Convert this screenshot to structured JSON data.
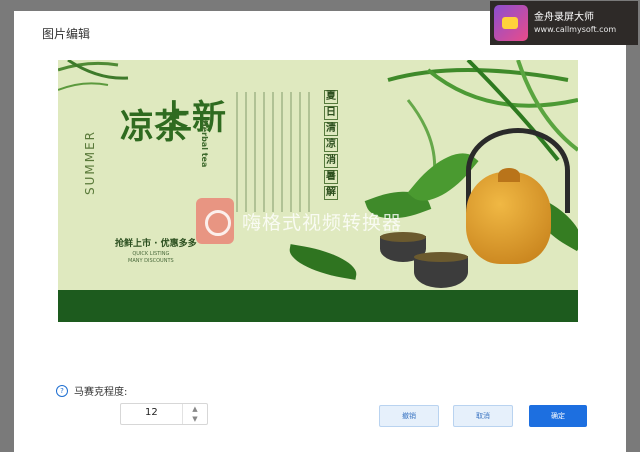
{
  "dialog": {
    "title": "图片编辑"
  },
  "banner": {
    "title_part1": "凉茶",
    "title_part2": "上新",
    "summer": "SUMMER",
    "herbal": "Herbal tea",
    "tagline": "抢鲜上市 · 优惠多多",
    "tagline_sub_1": "QUICK LISTING",
    "tagline_sub_2": "MANY DISCOUNTS",
    "vertical_slogan": [
      "夏",
      "日",
      "清",
      "凉",
      "消",
      "暑",
      "解"
    ]
  },
  "watermark": {
    "text": "嗨格式视频转换器"
  },
  "mosaic": {
    "label": "马赛克程度:",
    "value": "12",
    "up_icon": "chevron-up-icon",
    "down_icon": "chevron-down-icon"
  },
  "buttons": {
    "reset": "撤销",
    "cancel": "取消",
    "ok": "确定"
  },
  "recorder_badge": {
    "name": "金舟录屏大师",
    "url": "www.callmysoft.com"
  },
  "colors": {
    "primary": "#1d6fe0",
    "banner_bg": "#dfe9bf",
    "banner_band": "#1d5b1e"
  }
}
